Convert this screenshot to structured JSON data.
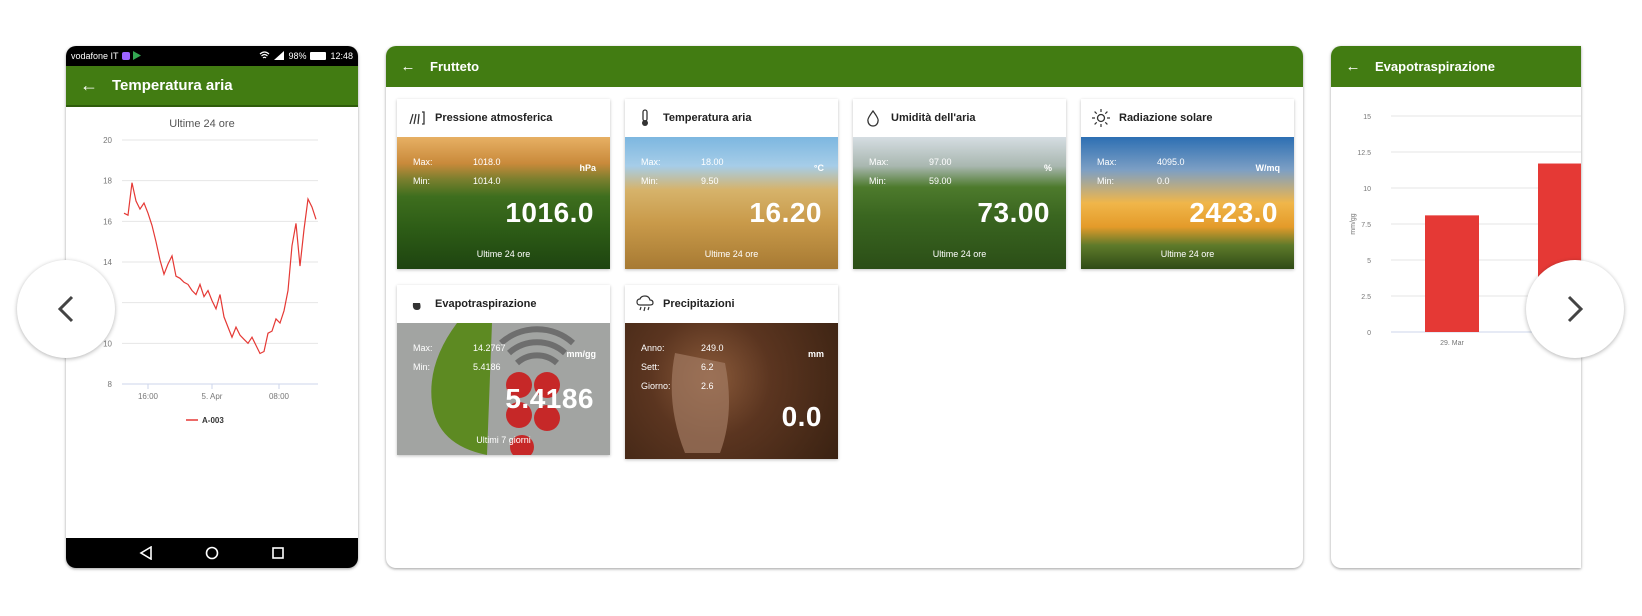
{
  "phone": {
    "status": {
      "carrier": "vodafone IT",
      "battery": "98%",
      "time": "12:48"
    },
    "appbar": {
      "back_icon": "arrow-left-icon",
      "title": "Temperatura aria"
    },
    "chart_data": {
      "type": "line",
      "title": "Ultime 24 ore",
      "xlabel": "",
      "ylabel": "",
      "x_tick_labels": [
        "16:00",
        "5. Apr",
        "08:00"
      ],
      "yticks": [
        8,
        10,
        12,
        14,
        16,
        18,
        20
      ],
      "ylim": [
        8,
        20
      ],
      "grid": true,
      "legend_position": "bottom-center",
      "series": [
        {
          "name": "A-003",
          "color": "#e53935",
          "values": [
            16.4,
            16.3,
            17.9,
            17.0,
            16.6,
            16.9,
            16.4,
            15.8,
            15.0,
            14.1,
            13.4,
            13.9,
            14.3,
            13.3,
            13.2,
            13.0,
            12.9,
            12.6,
            12.4,
            12.9,
            12.3,
            12.6,
            12.1,
            11.7,
            12.4,
            11.3,
            10.8,
            10.3,
            10.8,
            10.4,
            10.2,
            10.0,
            10.3,
            9.9,
            9.5,
            9.6,
            10.5,
            10.6,
            11.2,
            11.0,
            11.6,
            12.6,
            14.8,
            15.9,
            13.8,
            15.6,
            17.1,
            16.7,
            16.1
          ]
        }
      ]
    }
  },
  "tablet": {
    "appbar": {
      "back_icon": "arrow-left-icon",
      "title": "Frutteto"
    },
    "tiles": [
      {
        "title": "Pressione atmosferica",
        "icon": "barometer-icon",
        "max_label": "Max:",
        "max": "1018.0",
        "min_label": "Min:",
        "min": "1014.0",
        "unit": "hPa",
        "value": "1016.0",
        "period": "Ultime 24 ore"
      },
      {
        "title": "Temperatura aria",
        "icon": "thermometer-icon",
        "max_label": "Max:",
        "max": "18.00",
        "min_label": "Min:",
        "min": "9.50",
        "unit": "°C",
        "value": "16.20",
        "period": "Ultime 24 ore"
      },
      {
        "title": "Umidità dell'aria",
        "icon": "droplet-icon",
        "max_label": "Max:",
        "max": "97.00",
        "min_label": "Min:",
        "min": "59.00",
        "unit": "%",
        "value": "73.00",
        "period": "Ultime 24 ore"
      },
      {
        "title": "Radiazione solare",
        "icon": "sun-icon",
        "max_label": "Max:",
        "max": "4095.0",
        "min_label": "Min:",
        "min": "0.0",
        "unit": "W/mq",
        "value": "2423.0",
        "period": "Ultime 24 ore"
      },
      {
        "title": "Evapotraspirazione",
        "icon": "leaf-drop-icon",
        "max_label": "Max:",
        "max": "14.2767",
        "min_label": "Min:",
        "min": "5.4186",
        "unit": "mm/gg",
        "value": "5.4186",
        "period": "Ultimi 7 giorni"
      },
      {
        "title": "Precipitazioni",
        "icon": "rain-cloud-icon",
        "r1_label": "Anno:",
        "r1": "249.0",
        "r2_label": "Sett:",
        "r2": "6.2",
        "r3_label": "Giorno:",
        "r3": "2.6",
        "unit": "mm",
        "value": "0.0"
      }
    ]
  },
  "right": {
    "appbar": {
      "back_icon": "arrow-left-icon",
      "title": "Evapotraspirazione"
    },
    "chart_data": {
      "type": "bar",
      "ylabel": "mm/gg",
      "yticks": [
        "0",
        "2.5",
        "5",
        "7.5",
        "10",
        "12.5",
        "15"
      ],
      "ylim": [
        0,
        15
      ],
      "categories": [
        "29. Mar",
        ""
      ],
      "series": [
        {
          "color": "#e53935",
          "values": [
            8.1,
            11.7
          ]
        }
      ],
      "grid": true
    }
  },
  "carousel": {
    "prev_icon": "chevron-left-icon",
    "next_icon": "chevron-right-icon"
  }
}
